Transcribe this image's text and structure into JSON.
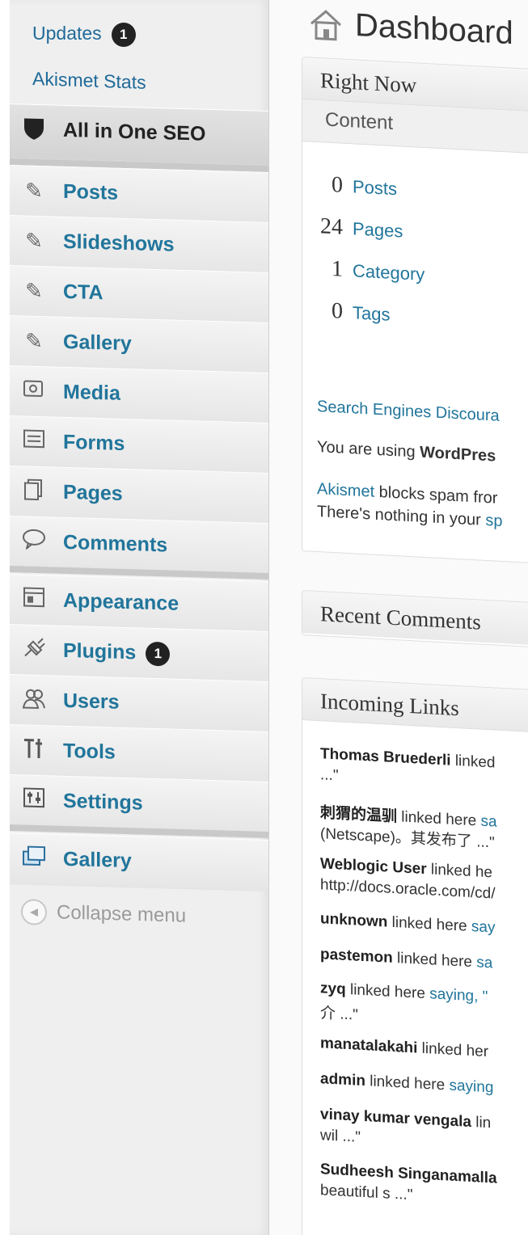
{
  "sidebar": {
    "updates_label": "Updates",
    "updates_count": "1",
    "akismet_stats": "Akismet Stats",
    "items": [
      {
        "label": "All in One SEO",
        "icon": "shield-icon"
      },
      {
        "label": "Posts",
        "icon": "pin-icon"
      },
      {
        "label": "Slideshows",
        "icon": "pin-icon"
      },
      {
        "label": "CTA",
        "icon": "pin-icon"
      },
      {
        "label": "Gallery",
        "icon": "pin-icon"
      },
      {
        "label": "Media",
        "icon": "media-icon"
      },
      {
        "label": "Forms",
        "icon": "forms-icon"
      },
      {
        "label": "Pages",
        "icon": "pages-icon"
      },
      {
        "label": "Comments",
        "icon": "comment-icon"
      },
      {
        "label": "Appearance",
        "icon": "appearance-icon"
      },
      {
        "label": "Plugins",
        "icon": "plugin-icon"
      },
      {
        "label": "Users",
        "icon": "users-icon"
      },
      {
        "label": "Tools",
        "icon": "tools-icon"
      },
      {
        "label": "Settings",
        "icon": "settings-icon"
      },
      {
        "label": "Gallery",
        "icon": "gallery-icon"
      }
    ],
    "plugins_count": "1",
    "collapse_label": "Collapse menu"
  },
  "main": {
    "title": "Dashboard",
    "right_now": {
      "title": "Right Now",
      "content_label": "Content",
      "counts": [
        {
          "num": "0",
          "label": "Posts"
        },
        {
          "num": "24",
          "label": "Pages"
        },
        {
          "num": "1",
          "label": "Category"
        },
        {
          "num": "0",
          "label": "Tags"
        }
      ],
      "search_engines": "Search Engines Discoura",
      "using_prefix": "You are using ",
      "using_bold": "WordPres",
      "akismet_link": "Akismet",
      "akismet_text": " blocks spam fror",
      "nothing_prefix": "There's nothing in your ",
      "nothing_link": "sp"
    },
    "recent_comments": {
      "title": "Recent Comments"
    },
    "incoming_links": {
      "title": "Incoming Links",
      "items": [
        {
          "name": "Thomas Bruederli",
          "text": " linked",
          "link": ""
        },
        {
          "name": "",
          "text": "...\"",
          "link": ""
        },
        {
          "name": "刺猬的温驯",
          "text": " linked here ",
          "link": "sa"
        },
        {
          "name": "",
          "text": "(Netscape)。其发布了 ...\"",
          "link": ""
        },
        {
          "name": "Weblogic User",
          "text": " linked he",
          "link": ""
        },
        {
          "name": "",
          "text": "http://docs.oracle.com/cd/",
          "link": ""
        },
        {
          "name": "unknown",
          "text": " linked here ",
          "link": "say"
        },
        {
          "name": "pastemon",
          "text": " linked here ",
          "link": "sa"
        },
        {
          "name": "zyq",
          "text": " linked here ",
          "link": "saying, \""
        },
        {
          "name": "",
          "text": "介 ...\"",
          "link": ""
        },
        {
          "name": "manatalakahi",
          "text": " linked her",
          "link": ""
        },
        {
          "name": "admin",
          "text": " linked here ",
          "link": "saying"
        },
        {
          "name": "vinay kumar vengala",
          "text": " lin",
          "link": ""
        },
        {
          "name": "",
          "text": "wil ...\"",
          "link": ""
        },
        {
          "name": "Sudheesh Singanamalla",
          "text": "",
          "link": ""
        },
        {
          "name": "",
          "text": "beautiful s ...\"",
          "link": ""
        }
      ]
    }
  }
}
